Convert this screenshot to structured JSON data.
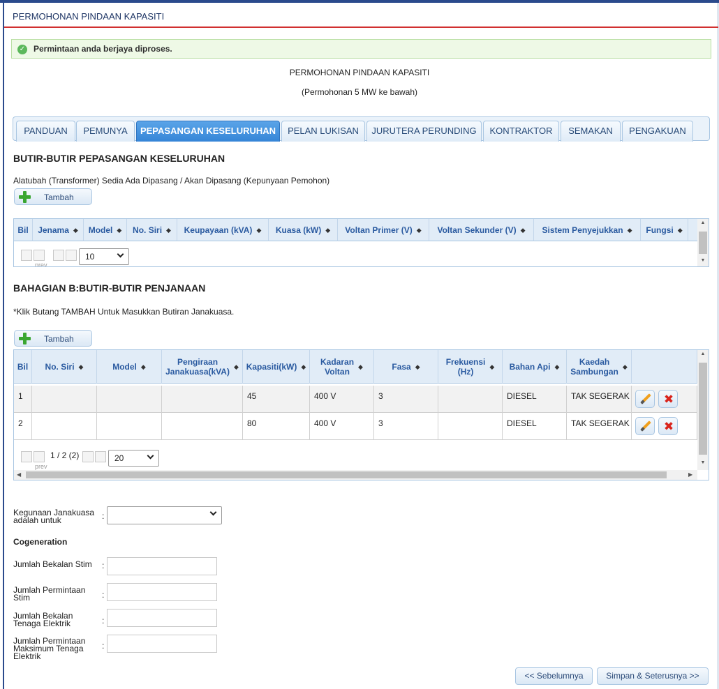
{
  "page": {
    "title": "PERMOHONAN PINDAAN KAPASITI"
  },
  "alert": {
    "message": "Permintaan anda berjaya diproses."
  },
  "form_header": {
    "title": "PERMOHONAN PINDAAN KAPASITI",
    "subtitle": "(Permohonan 5 MW ke bawah)"
  },
  "tabs": [
    {
      "label": "PANDUAN"
    },
    {
      "label": "PEMUNYA"
    },
    {
      "label": "PEPASANGAN KESELURUHAN"
    },
    {
      "label": "PELAN LUKISAN"
    },
    {
      "label": "JURUTERA PERUNDING"
    },
    {
      "label": "KONTRAKTOR"
    },
    {
      "label": "SEMAKAN"
    },
    {
      "label": "PENGAKUAN"
    }
  ],
  "active_tab": "PEPASANGAN KESELURUHAN",
  "section1": {
    "heading": "BUTIR-BUTIR PEPASANGAN KESELURUHAN",
    "note": "Alatubah (Transformer) Sedia Ada Dipasang / Akan Dipasang (Kepunyaan Pemohon)",
    "add_label": "Tambah",
    "columns": [
      "Bil",
      "Jenama",
      "Model",
      "No. Siri",
      "Keupayaan (kVA)",
      "Kuasa (kW)",
      "Voltan Primer (V)",
      "Voltan Sekunder (V)",
      "Sistem Penyejukkan",
      "Fungsi"
    ],
    "pager": {
      "prev_text": "prev",
      "page_size": "10"
    }
  },
  "section2": {
    "heading": "BAHAGIAN B:BUTIR-BUTIR PENJANAAN",
    "note": "*Klik Butang TAMBAH Untuk Masukkan Butiran Janakuasa.",
    "add_label": "Tambah",
    "columns": [
      {
        "line1": "Bil"
      },
      {
        "line1": "No. Siri"
      },
      {
        "line1": "Model"
      },
      {
        "line1": "Pengiraan",
        "line2": "Janakuasa(kVA)"
      },
      {
        "line1": "Kapasiti(kW)"
      },
      {
        "line1": "Kadaran",
        "line2": "Voltan"
      },
      {
        "line1": "Fasa"
      },
      {
        "line1": "Frekuensi",
        "line2": "(Hz)"
      },
      {
        "line1": "Bahan Api"
      },
      {
        "line1": "Kaedah",
        "line2": "Sambungan"
      }
    ],
    "rows": [
      {
        "bil": "1",
        "no_siri": "",
        "model": "",
        "pengiraan": "",
        "kapasiti": "45",
        "voltan": "400 V",
        "fasa": "3",
        "frekuensi": "",
        "bahan_api": "DIESEL",
        "kaedah": "TAK SEGERAK"
      },
      {
        "bil": "2",
        "no_siri": "",
        "model": "",
        "pengiraan": "",
        "kapasiti": "80",
        "voltan": "400 V",
        "fasa": "3",
        "frekuensi": "",
        "bahan_api": "DIESEL",
        "kaedah": "TAK SEGERAK"
      }
    ],
    "pager": {
      "prev_text": "prev",
      "page_info": "1 / 2 (2)",
      "page_size": "20"
    }
  },
  "form": {
    "kegunaan_label": "Kegunaan Janakuasa adalah untuk",
    "kegunaan_value": "",
    "cogeneration_heading": "Cogeneration",
    "fields": [
      {
        "label": "Jumlah Bekalan Stim",
        "value": ""
      },
      {
        "label": "Jumlah Permintaan Stim",
        "value": ""
      },
      {
        "label": "Jumlah Bekalan Tenaga Elektrik",
        "value": ""
      },
      {
        "label": "Jumlah Permintaan Maksimum Tenaga Elektrik",
        "value": ""
      }
    ],
    "colon": ":"
  },
  "nav": {
    "prev_label": "<< Sebelumnya",
    "next_label": "Simpan & Seterusnya >>"
  },
  "colors": {
    "accent": "#3585d7",
    "header_border": "#d13030",
    "brand": "#2a4a8c"
  }
}
